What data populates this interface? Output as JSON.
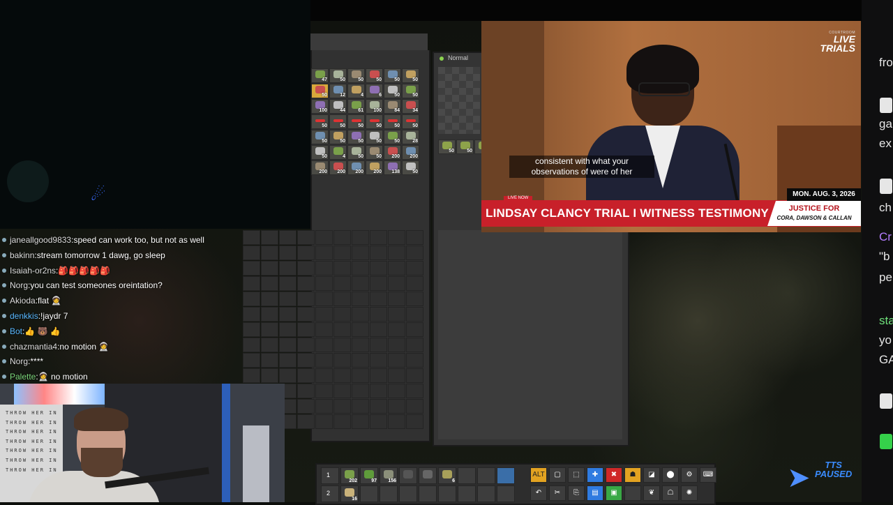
{
  "video": {
    "caption": "consistent with what your observations of were of her",
    "logo_small": "COURTROOM",
    "logo_big_1": "LIVE",
    "logo_big_2": "TRIALS",
    "live_now": "LIVE NOW",
    "headline": "LINDSAY CLANCY TRIAL I WITNESS TESTIMONY",
    "date": "MON. AUG. 3, 2026",
    "justice_title": "JUSTICE FOR",
    "justice_names": "CORA, DAWSON & CALLAN"
  },
  "chat": [
    {
      "user": "janeallgood9833",
      "message": "speed can work too, but not as well",
      "color": "default"
    },
    {
      "user": "bakinn",
      "message": "stream tomorrow 1 dawg, go sleep",
      "color": "default"
    },
    {
      "user": "Isaiah-or2ns",
      "message": "🎒🎒🎒🎒🎒",
      "color": "default"
    },
    {
      "user": "Norg",
      "message": "you can test someones oreintation?",
      "color": "default"
    },
    {
      "user": "Akioda",
      "message": "flat 🧑‍🚀",
      "color": "default"
    },
    {
      "user": "denkkis",
      "message": "!jaydr 7",
      "color": "blue"
    },
    {
      "user": "Bot",
      "message": "👍 🐻 👍",
      "color": "blue"
    },
    {
      "user": "chazmantia4",
      "message": "no motion 🧑‍🚀",
      "color": "default"
    },
    {
      "user": "Norg",
      "message": "****",
      "color": "default"
    },
    {
      "user": "Palette",
      "message": "🧑‍🚀 no motion",
      "color": "green"
    }
  ],
  "inventory": {
    "rows": [
      [
        "47",
        "50",
        "50",
        "50",
        "50",
        "50"
      ],
      [
        "50",
        "12",
        "4",
        "6",
        "50",
        "50"
      ],
      [
        "100",
        "44",
        "61",
        "100",
        "84",
        "34"
      ],
      [
        "50",
        "50",
        "50",
        "50",
        "50",
        "50"
      ],
      [
        "50",
        "50",
        "50",
        "50",
        "50",
        "28"
      ],
      [
        "50",
        "4",
        "50",
        "50",
        "200",
        "200"
      ],
      [
        "200",
        "200",
        "200",
        "200",
        "138",
        "50"
      ]
    ]
  },
  "right_panel": {
    "mode_label": "Normal",
    "slot_counts": [
      "50",
      "50"
    ]
  },
  "hotbar": {
    "row1_number": "1",
    "row2_number": "2",
    "row1_counts": [
      "202",
      "97",
      "156",
      "",
      "",
      "6"
    ],
    "row2_counts": [
      "16"
    ],
    "toggle_label": "ALT"
  },
  "webcam": {
    "poster_line": "THROW HER IN"
  },
  "right_chat_edge": {
    "lines": [
      "fro",
      "ga",
      "ex",
      "ch",
      "Cr",
      "\"b",
      "pe",
      "sta",
      "yo",
      "GA"
    ]
  },
  "tts": {
    "line1": "TTS",
    "line2": "PAUSED"
  },
  "colors": {
    "headline_bar": "#c8202a",
    "hotbar_yellow": "#e3a321",
    "hotbar_blue": "#2f7be0"
  }
}
